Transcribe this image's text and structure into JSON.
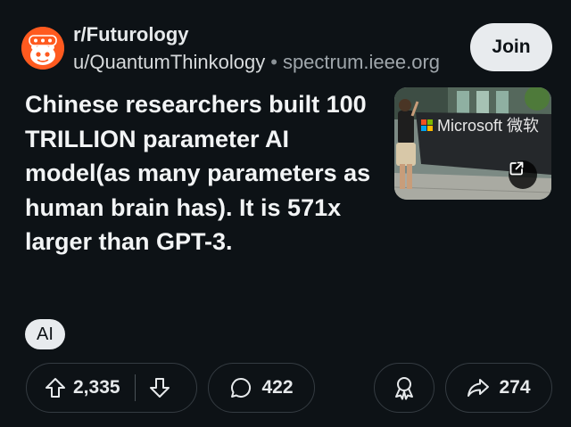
{
  "post": {
    "subreddit": "r/Futurology",
    "author": "u/QuantumThinkology",
    "separator": "•",
    "domain": "spectrum.ieee.org",
    "join_label": "Join",
    "title": "Chinese researchers built 100 TRILLION parameter AI model(as many parameters as human brain has). It is 571x larger than GPT-3.",
    "flair": "AI",
    "thumbnail": {
      "sign_text": "Microsoft 微软",
      "icon": "external-link-icon"
    }
  },
  "actions": {
    "upvote_icon": "upvote-arrow-icon",
    "score": "2,335",
    "downvote_icon": "downvote-arrow-icon",
    "comment_icon": "comment-bubble-icon",
    "comments": "422",
    "award_icon": "award-icon",
    "share_icon": "share-arrow-icon",
    "shares": "274"
  },
  "colors": {
    "background": "#0d1216",
    "subreddit_avatar": "#ff5a1f",
    "button_light": "#e8ebee",
    "pill_border": "#343b41"
  }
}
